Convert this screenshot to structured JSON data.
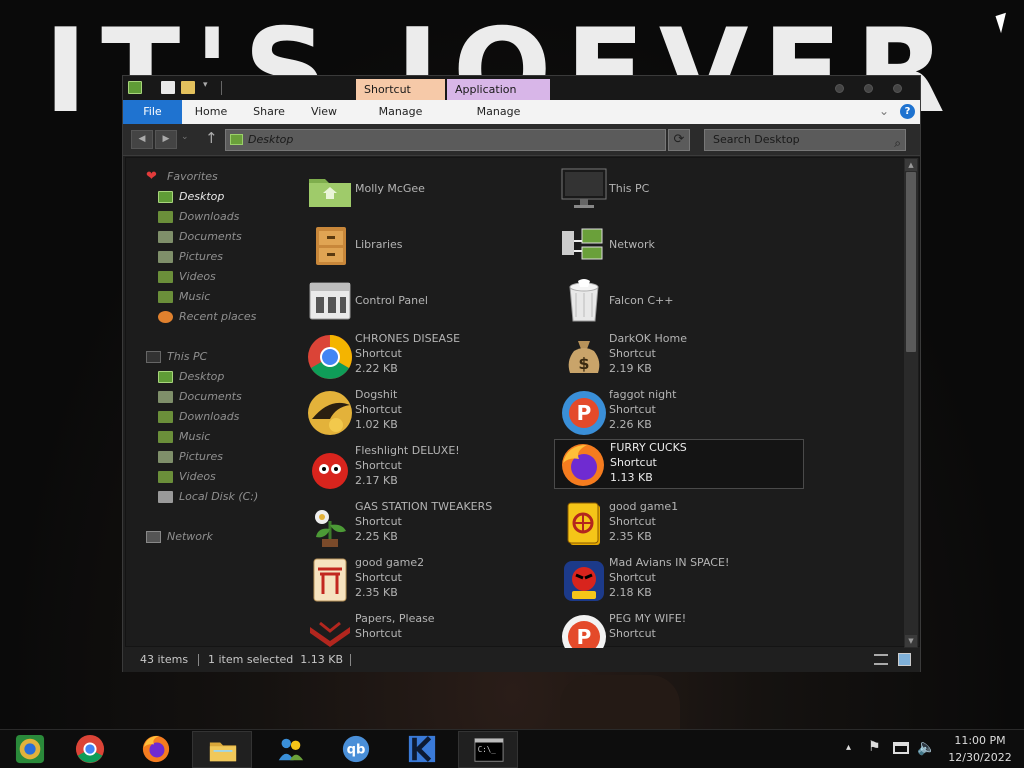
{
  "wallpaper": {
    "text": "IT'S JOEVER"
  },
  "window": {
    "context_tabs": [
      {
        "label": "Shortcut Tools",
        "color": "#f6c9a8"
      },
      {
        "label": "Application Tools",
        "color": "#d8b6e8"
      }
    ],
    "ribbon_tabs": [
      "File",
      "Home",
      "Share",
      "View",
      "Manage",
      "Manage"
    ],
    "help_icon": "help-icon",
    "address": "Desktop",
    "search_placeholder": "Search Desktop",
    "nav": {
      "favorites_label": "Favorites",
      "favorites": [
        "Desktop",
        "Downloads",
        "Documents",
        "Pictures",
        "Videos",
        "Music",
        "Recent places"
      ],
      "thispc_label": "This PC",
      "thispc": [
        "Desktop",
        "Documents",
        "Downloads",
        "Music",
        "Pictures",
        "Videos",
        "Local Disk (C:)"
      ],
      "network_label": "Network"
    },
    "items": [
      {
        "name": "Molly McGee",
        "icon": "user-folder-icon"
      },
      {
        "name": "This PC",
        "icon": "monitor-icon"
      },
      {
        "name": "Libraries",
        "icon": "library-icon"
      },
      {
        "name": "Network",
        "icon": "network-icon"
      },
      {
        "name": "Control Panel",
        "icon": "control-panel-icon"
      },
      {
        "name": "Falcon C++",
        "icon": "recycle-bin-icon"
      },
      {
        "name": "CHRONES DISEASE",
        "type": "Shortcut",
        "size": "2.22 KB",
        "icon": "chrome-icon"
      },
      {
        "name": "DarkOK Home",
        "type": "Shortcut",
        "size": "2.19 KB",
        "icon": "money-bag-icon"
      },
      {
        "name": "Dogshit",
        "type": "Shortcut",
        "size": "1.02 KB",
        "icon": "cpp-compiler-icon"
      },
      {
        "name": "faggot night",
        "type": "Shortcut",
        "size": "2.26 KB",
        "icon": "p-logo-icon"
      },
      {
        "name": "Fleshlight DELUXE!",
        "type": "Shortcut",
        "size": "2.17 KB",
        "icon": "red-creature-icon"
      },
      {
        "name": "FURRY CUCKS",
        "type": "Shortcut",
        "size": "1.13 KB",
        "icon": "firefox-icon",
        "selected": true
      },
      {
        "name": "GAS STATION TWEAKERS",
        "type": "Shortcut",
        "size": "2.25 KB",
        "icon": "plant-icon"
      },
      {
        "name": "good game1",
        "type": "Shortcut",
        "size": "2.35 KB",
        "icon": "mahjong-tile-icon"
      },
      {
        "name": "good game2",
        "type": "Shortcut",
        "size": "2.35 KB",
        "icon": "torii-tile-icon"
      },
      {
        "name": "Mad Avians IN SPACE!",
        "type": "Shortcut",
        "size": "2.18 KB",
        "icon": "angry-bird-icon"
      },
      {
        "name": "Papers, Please",
        "type": "Shortcut",
        "size": "",
        "icon": "eagle-emblem-icon"
      },
      {
        "name": "PEG MY WIFE!",
        "type": "Shortcut",
        "size": "",
        "icon": "p-logo-icon"
      }
    ],
    "status": {
      "count": "43 items",
      "selection": "1 item selected  1.13 KB"
    }
  },
  "taskbar": {
    "apps": [
      {
        "name": "chrome-old-icon"
      },
      {
        "name": "chrome-icon"
      },
      {
        "name": "firefox-icon"
      },
      {
        "name": "file-explorer-icon"
      },
      {
        "name": "network-people-icon"
      },
      {
        "name": "qbittorrent-icon"
      },
      {
        "name": "dark-k-icon"
      },
      {
        "name": "terminal-icon"
      }
    ],
    "time": "11:00 PM",
    "date": "12/30/2022"
  }
}
